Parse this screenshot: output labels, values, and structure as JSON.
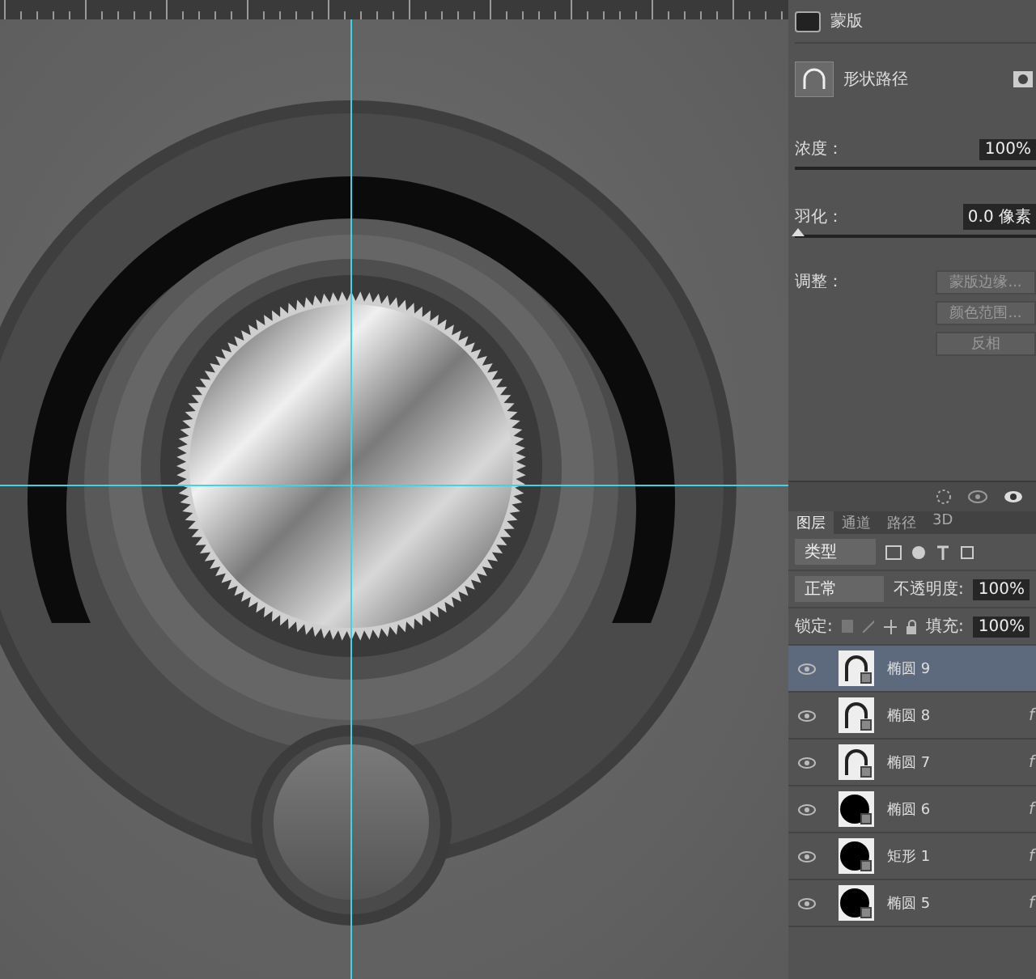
{
  "properties": {
    "title": "蒙版",
    "shape_label": "形状路径",
    "density": {
      "label": "浓度：",
      "value": "100%",
      "level": 1
    },
    "feather": {
      "label": "羽化：",
      "value": "0.0 像素",
      "level": 0
    },
    "adjust_label": "调整：",
    "buttons": [
      "蒙版边缘...",
      "颜色范围...",
      "反相"
    ]
  },
  "layers_panel": {
    "tabs": [
      {
        "label": "图层",
        "selected": true
      },
      {
        "label": "通道",
        "selected": false
      },
      {
        "label": "路径",
        "selected": false
      },
      {
        "label": "3D",
        "selected": false
      }
    ],
    "filter": "类型",
    "blend_mode": "正常",
    "opacity_label": "不透明度:",
    "opacity": "100%",
    "lock_label": "锁定:",
    "fill_label": "填充:",
    "fill": "100%",
    "layers": [
      {
        "name": "椭圆 9",
        "kind": "ring",
        "selected": true,
        "visible": true
      },
      {
        "name": "椭圆 8",
        "kind": "ring",
        "selected": false,
        "visible": true,
        "fx": "f"
      },
      {
        "name": "椭圆 7",
        "kind": "ring",
        "selected": false,
        "visible": true,
        "fx": "f"
      },
      {
        "name": "椭圆 6",
        "kind": "solid",
        "selected": false,
        "visible": true,
        "fx": "f"
      },
      {
        "name": "矩形 1",
        "kind": "solid",
        "selected": false,
        "visible": true,
        "fx": "f"
      },
      {
        "name": "椭圆 5",
        "kind": "solid",
        "selected": false,
        "visible": true,
        "fx": "f"
      }
    ]
  }
}
